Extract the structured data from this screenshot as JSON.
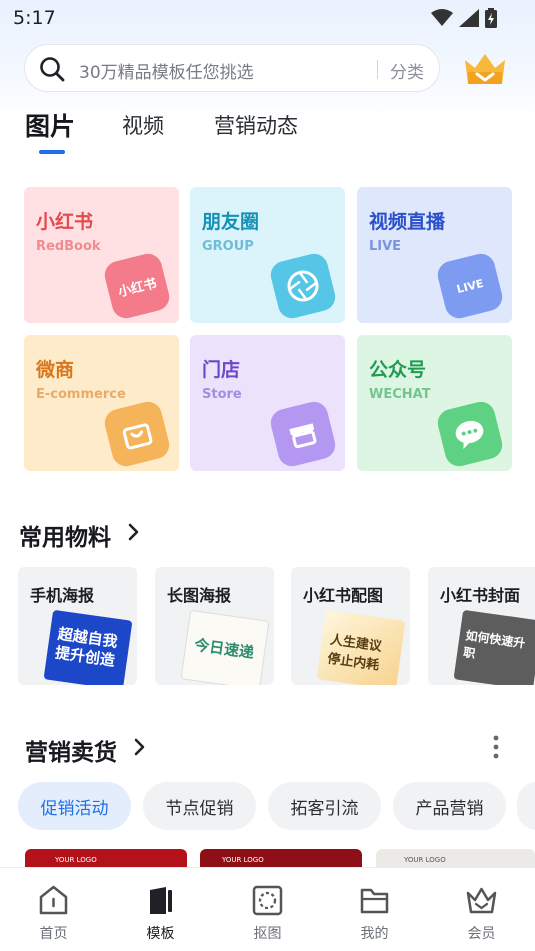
{
  "status": {
    "time": "5:17"
  },
  "search": {
    "placeholder": "30万精品模板任您挑选",
    "category": "分类"
  },
  "tabs": [
    "图片",
    "视频",
    "营销动态"
  ],
  "categories": [
    {
      "name": "小红书",
      "en": "RedBook",
      "badge": "小红书",
      "icon": "redbook-icon",
      "color": "#e5484d",
      "bg": "#ffe1e4",
      "iconbg": "#f47b8a"
    },
    {
      "name": "朋友圈",
      "en": "GROUP",
      "icon": "aperture-icon",
      "color": "#1691b6",
      "bg": "#dbf4fb",
      "iconbg": "#55c6e6"
    },
    {
      "name": "视频直播",
      "en": "LIVE",
      "badge": "LIVE",
      "icon": "live-camera-icon",
      "color": "#2b50c9",
      "bg": "#dfe7fc",
      "iconbg": "#7e9bf2"
    },
    {
      "name": "微商",
      "en": "E-commerce",
      "icon": "shopping-bag-icon",
      "color": "#d9771c",
      "bg": "#fdebc9",
      "iconbg": "#f6b45a"
    },
    {
      "name": "门店",
      "en": "Store",
      "icon": "store-icon",
      "color": "#6a48c9",
      "bg": "#ece2fb",
      "iconbg": "#b497f1"
    },
    {
      "name": "公众号",
      "en": "WECHAT",
      "icon": "wechat-icon",
      "color": "#1f9c4f",
      "bg": "#dcf6e3",
      "iconbg": "#5fd183"
    }
  ],
  "materials": {
    "title": "常用物料",
    "items": [
      {
        "label": "手机海报",
        "thumb_text": "超越自我 提升创造"
      },
      {
        "label": "长图海报",
        "thumb_text": "今日速递"
      },
      {
        "label": "小红书配图",
        "thumb_text": "人生建议 停止内耗"
      },
      {
        "label": "小红书封面",
        "thumb_text": "如何快速升职"
      }
    ]
  },
  "marketing": {
    "title": "营销卖货",
    "pills": [
      "促销活动",
      "节点促销",
      "拓客引流",
      "产品营销"
    ]
  },
  "preview_labels": [
    "YOUR LOGO",
    "YOUR LOGO",
    "YOUR LOGO"
  ],
  "nav": [
    "首页",
    "模板",
    "抠图",
    "我的",
    "会员"
  ],
  "colors": {
    "accent": "#1f6fe9"
  }
}
